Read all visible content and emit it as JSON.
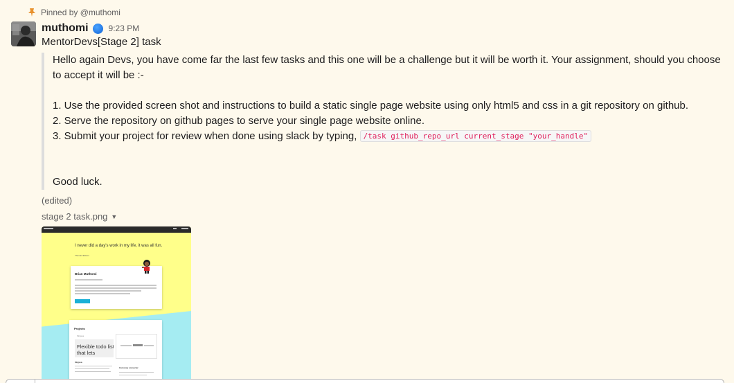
{
  "pinned": {
    "text": "Pinned by @muthomi",
    "icon": "pin-icon",
    "icon_color": "#e8912d"
  },
  "message": {
    "author": "muthomi",
    "status_icon": "status-dot-icon",
    "time": "9:23 PM",
    "title": "MentorDevs[Stage 2] task",
    "quote": {
      "intro": "Hello again Devs, you have come far the last few tasks and this one will be a challenge but it will be worth it. Your assignment, should you choose to accept it will be :-",
      "step1": "1. Use the provided screen shot and instructions to build a static single page website using only html5 and css in a git repository on github.",
      "step2": "2. Serve the repository on github pages to serve your single page website online.",
      "step3": "3. Submit your project for review when done using slack by typing,",
      "code": "/task github_repo_url current_stage \"your_handle\"",
      "closing": "Good luck."
    },
    "edited": "(edited)"
  },
  "attachment": {
    "file_name": "stage 2 task.png",
    "preview": {
      "quote": "I never did a day's work in my life, it was all fun.",
      "author": "Thomas Edison",
      "card_title": "Brian Muthomi",
      "projects_title": "Projects",
      "todo_text": "Flexible todo list that lets",
      "card_small_title": "Currency converter",
      "skypea": "Skypea"
    },
    "colors": {
      "yellow": "#ffff8a",
      "cyan": "#a5ecf2",
      "button": "#1ab0d6"
    }
  },
  "colors": {
    "background": "#fef9ec",
    "code_text": "#e01e5a",
    "status": "#1264d6"
  }
}
